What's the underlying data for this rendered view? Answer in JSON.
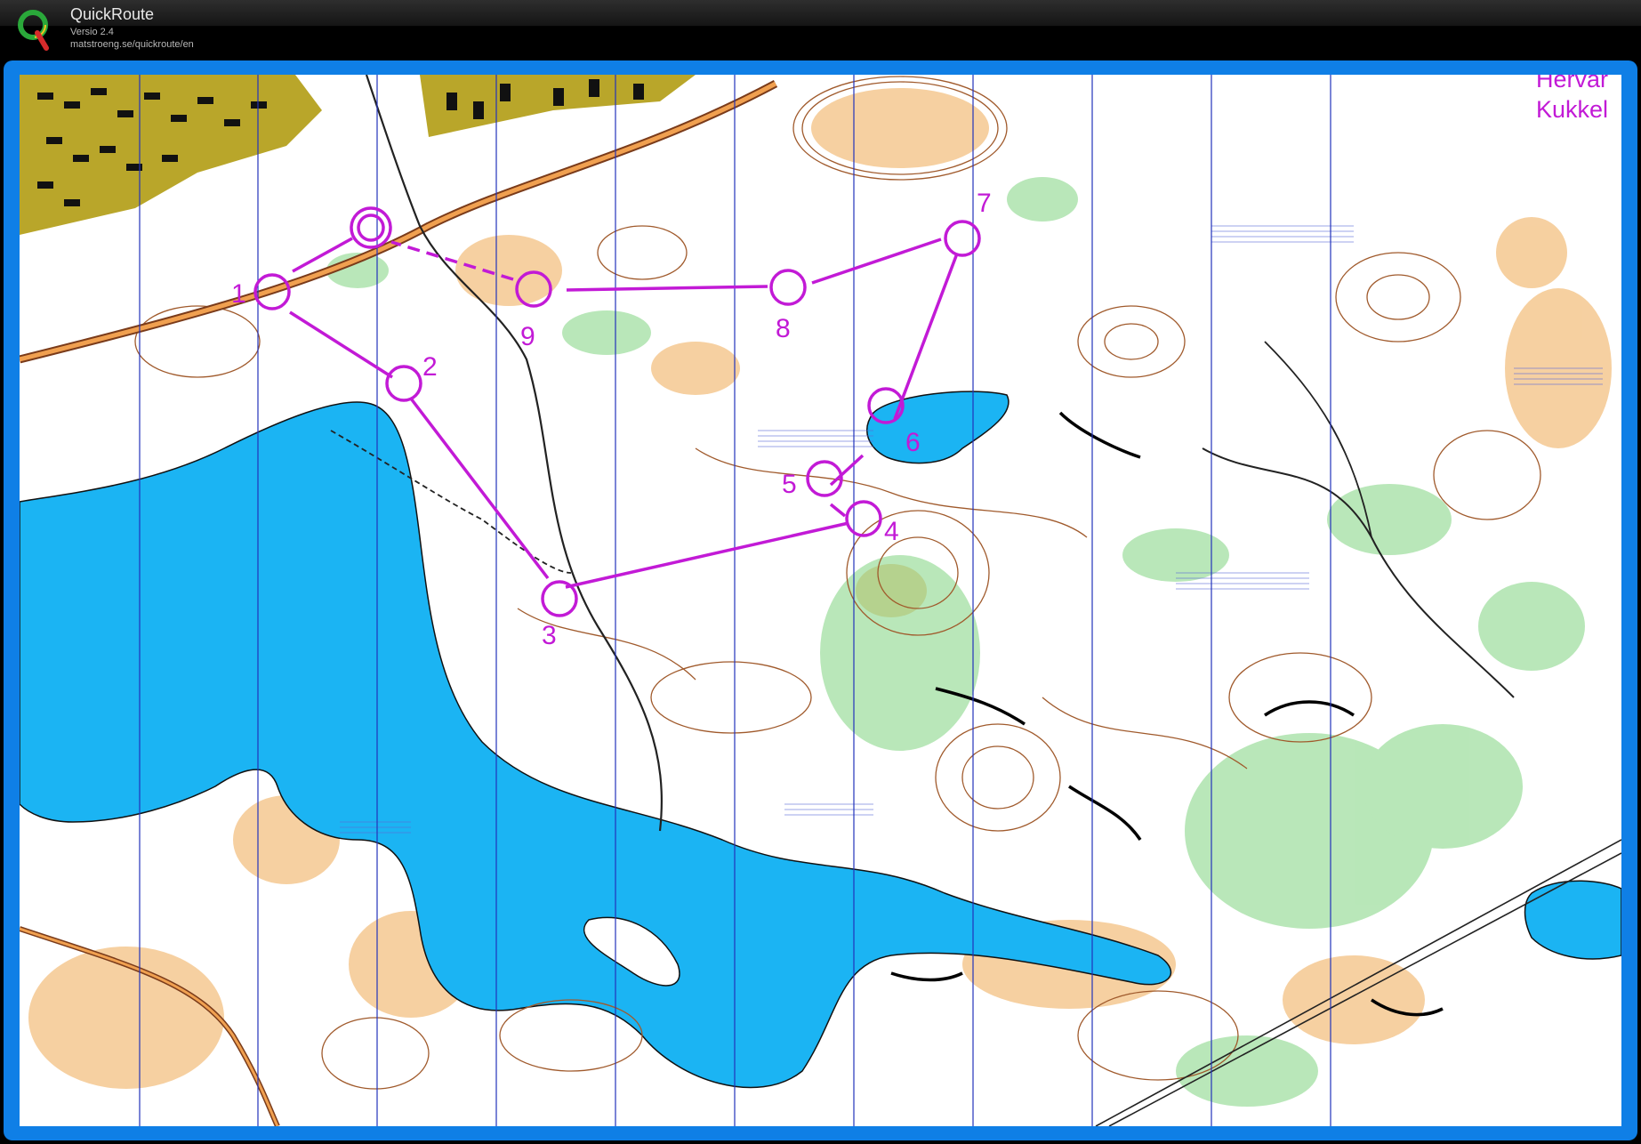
{
  "app": {
    "name": "QuickRoute",
    "version": "Versio 2.4",
    "url": "matstroeng.se/quickroute/en"
  },
  "colors": {
    "frame": "#0f7fe6",
    "course": "#c21ad6",
    "water": "#1bb4f3",
    "open_land": "#f5c890",
    "forest_green": "#7fd47f",
    "urban": "#b9a62a",
    "contour": "#a05a2c",
    "north_lines": "#2233bb"
  },
  "map": {
    "corner_text": [
      "Hervar",
      "Kukkel"
    ],
    "start_symbol": "start-triangle-circle",
    "controls": [
      {
        "number": "1"
      },
      {
        "number": "2"
      },
      {
        "number": "3"
      },
      {
        "number": "4"
      },
      {
        "number": "5"
      },
      {
        "number": "6"
      },
      {
        "number": "7"
      },
      {
        "number": "8"
      },
      {
        "number": "9"
      }
    ]
  }
}
